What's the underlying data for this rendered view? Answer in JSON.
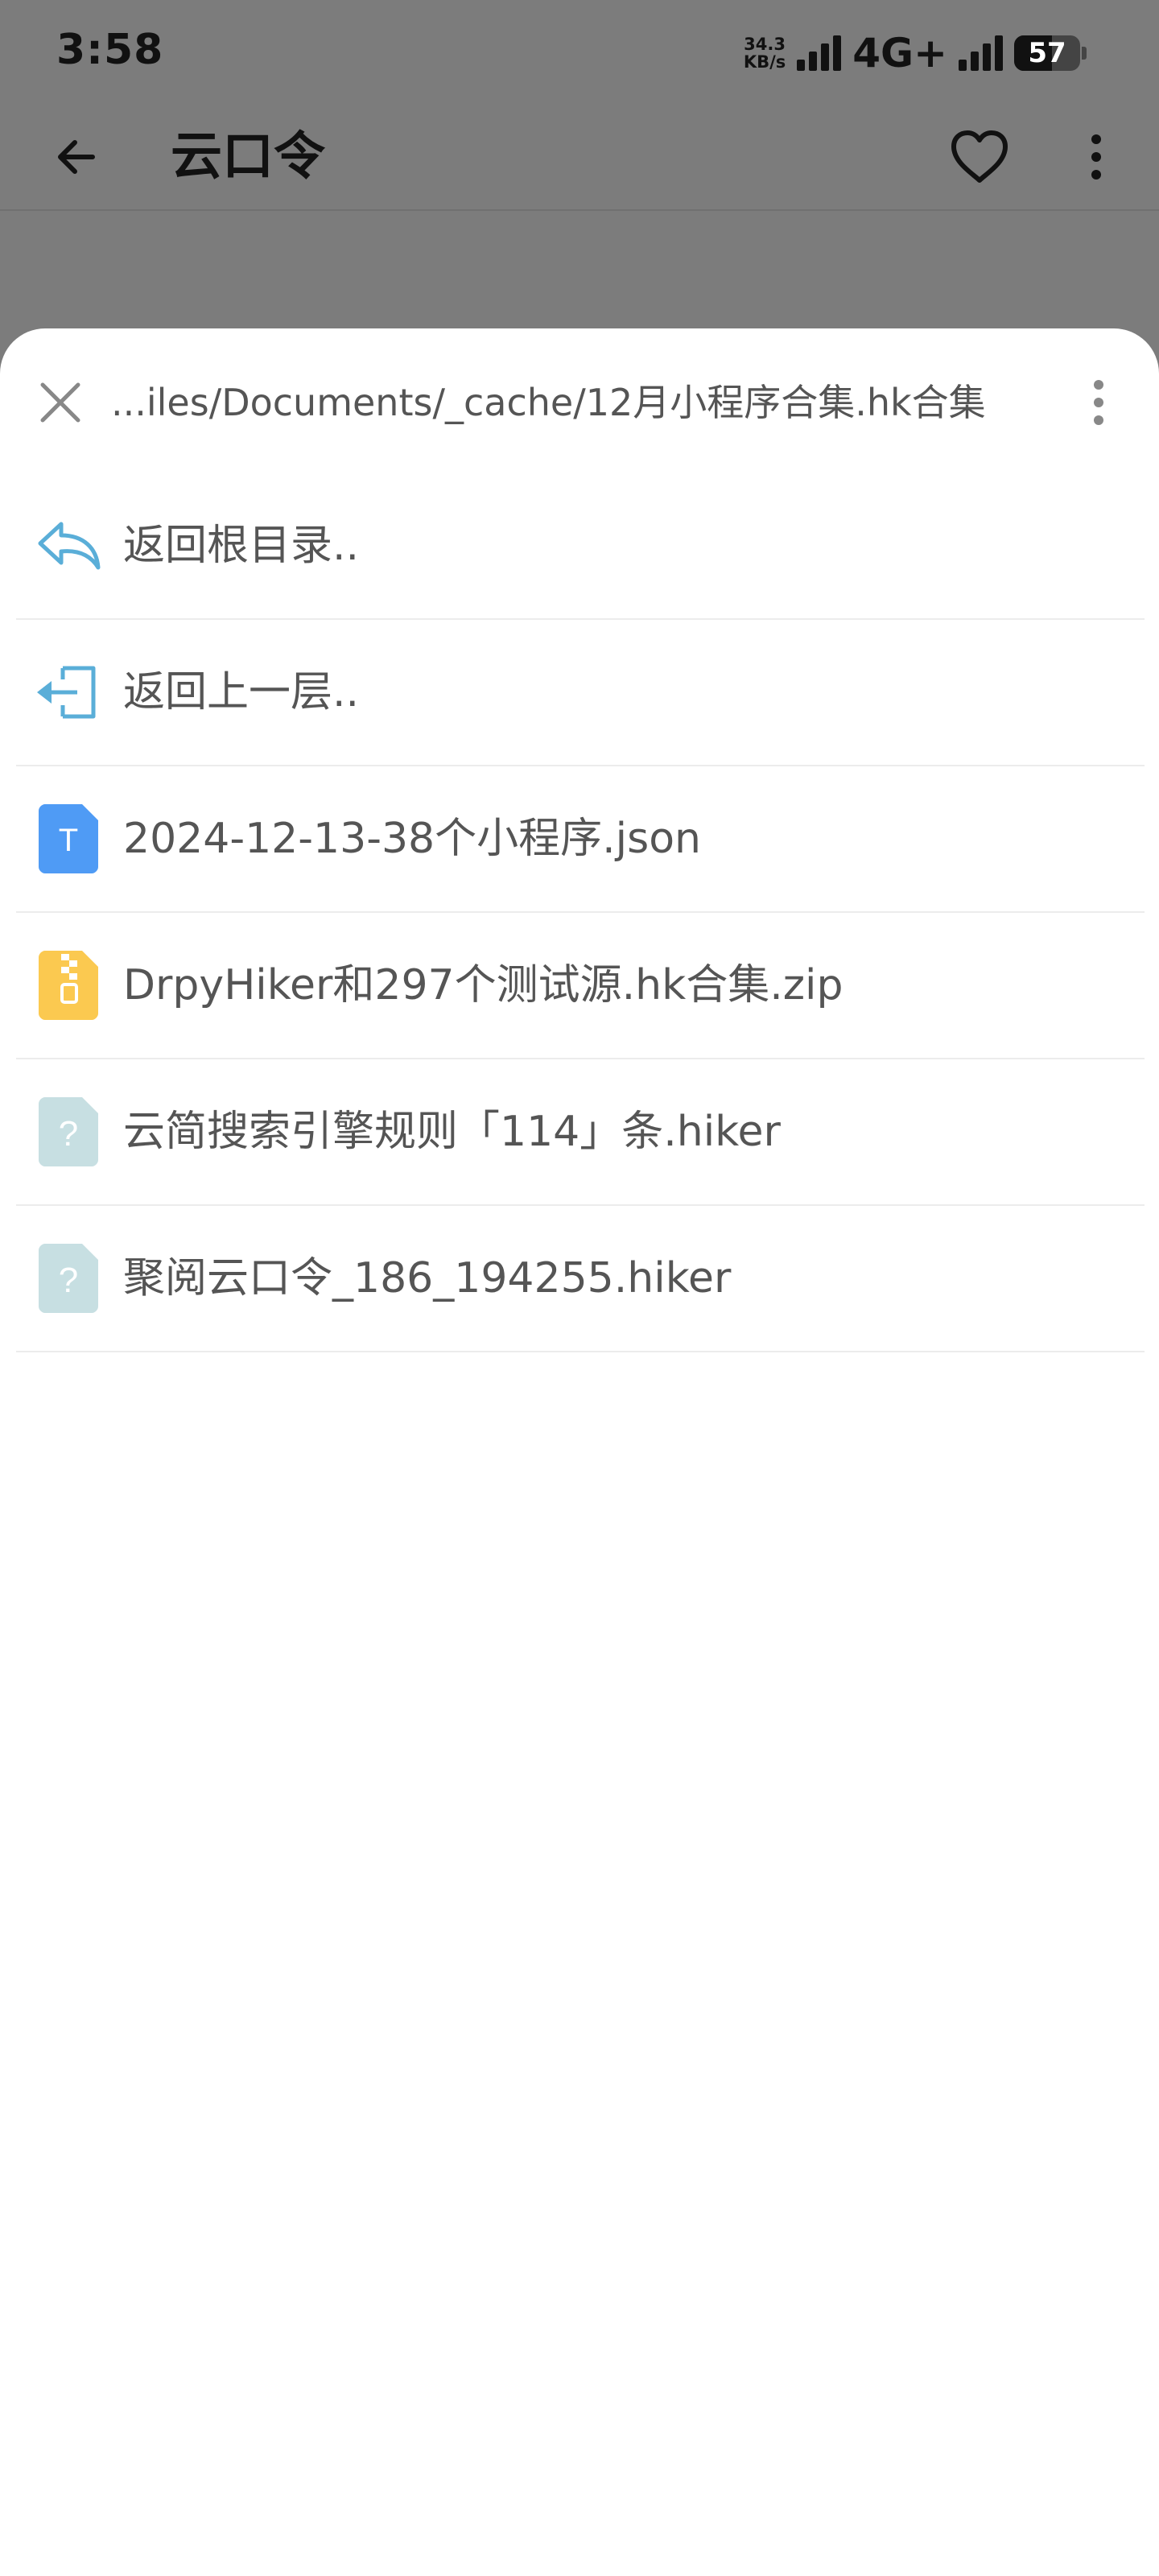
{
  "status_bar": {
    "time": "3:58",
    "net_speed_value": "34.3",
    "net_speed_unit": "KB/s",
    "network_type": "4G+",
    "battery_level": "57",
    "battery_fraction": 0.57
  },
  "app_bar": {
    "title": "云口令",
    "back_icon": "arrow-left-icon",
    "favorite_icon": "heart-outline-icon",
    "more_icon": "more-vertical-icon"
  },
  "sheet": {
    "path": "...iles/Documents/_cache/12月小程序合集.hk合集",
    "close_icon": "close-icon",
    "menu_icon": "more-vertical-icon",
    "items": [
      {
        "label": "返回根目录..",
        "icon": "reply-arrow-icon"
      },
      {
        "label": "返回上一层..",
        "icon": "exit-arrow-icon"
      },
      {
        "label": "2024-12-13-38个小程序.json",
        "icon": "text-file-icon",
        "icon_text": "T"
      },
      {
        "label": "DrpyHiker和297个测试源.hk合集.zip",
        "icon": "zip-file-icon"
      },
      {
        "label": "云简搜索引擎规则「114」条.hiker",
        "icon": "unknown-file-icon",
        "icon_text": "?"
      },
      {
        "label": "聚阅云口令_186_194255.hiker",
        "icon": "unknown-file-icon",
        "icon_text": "?"
      }
    ]
  },
  "colors": {
    "dim_overlay": "#7c7c7c",
    "sheet_background": "#ffffff",
    "text_file_blue": "#4f9bf5",
    "zip_yellow": "#fbc950",
    "unknown_file": "#c7dfe2",
    "nav_icon_blue": "#5aaed8"
  }
}
